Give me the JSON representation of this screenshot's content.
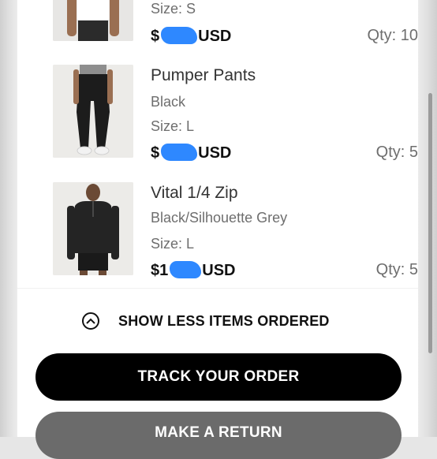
{
  "items": [
    {
      "name": "",
      "variant": "",
      "size": "Size: S",
      "price_prefix": "$",
      "price_currency": "USD",
      "qty": "Qty: 10",
      "image_icon": "product-image-white-tshirt"
    },
    {
      "name": "Pumper Pants",
      "variant": "Black",
      "size": "Size: L",
      "price_prefix": "$",
      "price_currency": "USD",
      "qty": "Qty: 5",
      "image_icon": "product-image-black-pants"
    },
    {
      "name": "Vital 1/4 Zip",
      "variant": "Black/Silhouette Grey",
      "size": "Size: L",
      "price_prefix": "$1",
      "price_currency": "USD",
      "qty": "Qty: 5",
      "image_icon": "product-image-black-quarter-zip"
    }
  ],
  "toggle": {
    "label": "SHOW LESS ITEMS ORDERED",
    "icon": "chevron-up-circle-icon"
  },
  "buttons": {
    "track": "TRACK YOUR ORDER",
    "return": "MAKE A RETURN"
  },
  "colors": {
    "primary_button": "#000000",
    "secondary_button": "#6b6b6b",
    "redaction": "#2e88ff"
  }
}
